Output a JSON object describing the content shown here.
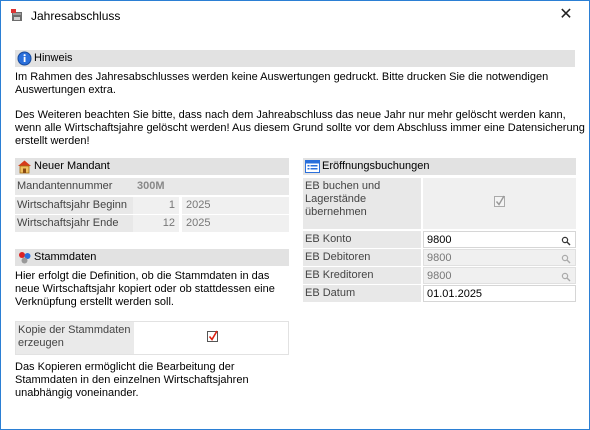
{
  "window": {
    "title": "Jahresabschluss",
    "close_symbol": "✕",
    "icon": "app-icon"
  },
  "hinweis": {
    "header": "Hinweis",
    "icon": "info-icon",
    "text1_line1": "Im Rahmen des Jahresabschlusses werden keine Auswertungen gedruckt. Bitte drucken Sie die notwendigen",
    "text1_line2": "Auswertungen extra.",
    "text2_line1": "Des Weiteren beachten Sie bitte, dass nach dem Jahreabschluss das neue Jahr nur mehr gelöscht werden kann,",
    "text2_line2": "wenn alle Wirtschaftsjahre gelöscht werden! Aus diesem Grund sollte vor dem Abschluss immer eine Datensicherung",
    "text2_line3": "erstellt werden!"
  },
  "mandant": {
    "header": "Neuer Mandant",
    "icon": "house-icon",
    "nummer_label": "Mandantennummer",
    "nummer_value": "300M",
    "beginn_label": "Wirtschaftsjahr Beginn",
    "beginn_month": "1",
    "beginn_year": "2025",
    "ende_label": "Wirtschaftsjahr Ende",
    "ende_month": "12",
    "ende_year": "2025"
  },
  "stammdaten": {
    "header": "Stammdaten",
    "icon": "stammdaten-icon",
    "desc_line1": "Hier erfolgt die Definition, ob die Stammdaten in das",
    "desc_line2": "neue Wirtschaftsjahr kopiert oder ob stattdessen eine",
    "desc_line3": "Verknüpfung erstellt werden soll.",
    "kopie_label_line1": "Kopie der Stammdaten",
    "kopie_label_line2": "erzeugen",
    "kopie_checked": true,
    "note_line1": "Das Kopieren ermöglicht die Bearbeitung der",
    "note_line2": "Stammdaten in den einzelnen Wirtschaftsjahren",
    "note_line3": "unabhängig voneinander."
  },
  "eroeffnung": {
    "header": "Eröffnungsbuchungen",
    "icon": "list-icon",
    "eb_buchen_line1": "EB buchen und",
    "eb_buchen_line2": "Lagerstände",
    "eb_buchen_line3": "übernehmen",
    "eb_buchen_checked": true,
    "konto_label": "EB Konto",
    "konto_value": "9800",
    "debitoren_label": "EB Debitoren",
    "debitoren_value": "9800",
    "kreditoren_label": "EB Kreditoren",
    "kreditoren_value": "9800",
    "datum_label": "EB Datum",
    "datum_value": "01.01.2025"
  }
}
